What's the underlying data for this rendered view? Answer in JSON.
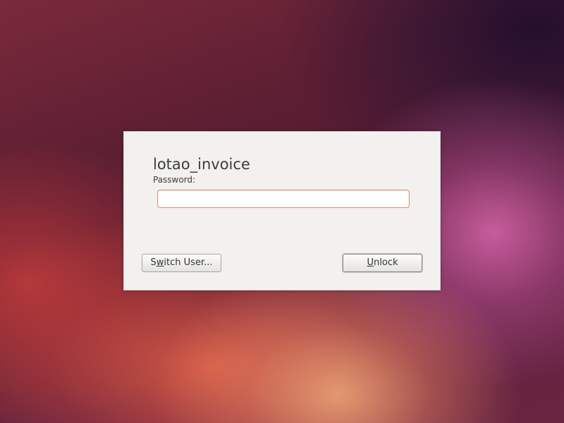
{
  "dialog": {
    "username": "lotao_invoice",
    "password_label": "Password:",
    "password_value": "",
    "switch_user_button": {
      "before": "S",
      "mnemonic": "w",
      "after": "itch User..."
    },
    "unlock_button": {
      "before": "",
      "mnemonic": "U",
      "after": "nlock"
    }
  },
  "colors": {
    "dialog_background": "#f2f1ef",
    "input_focus_border": "#e2906a"
  }
}
